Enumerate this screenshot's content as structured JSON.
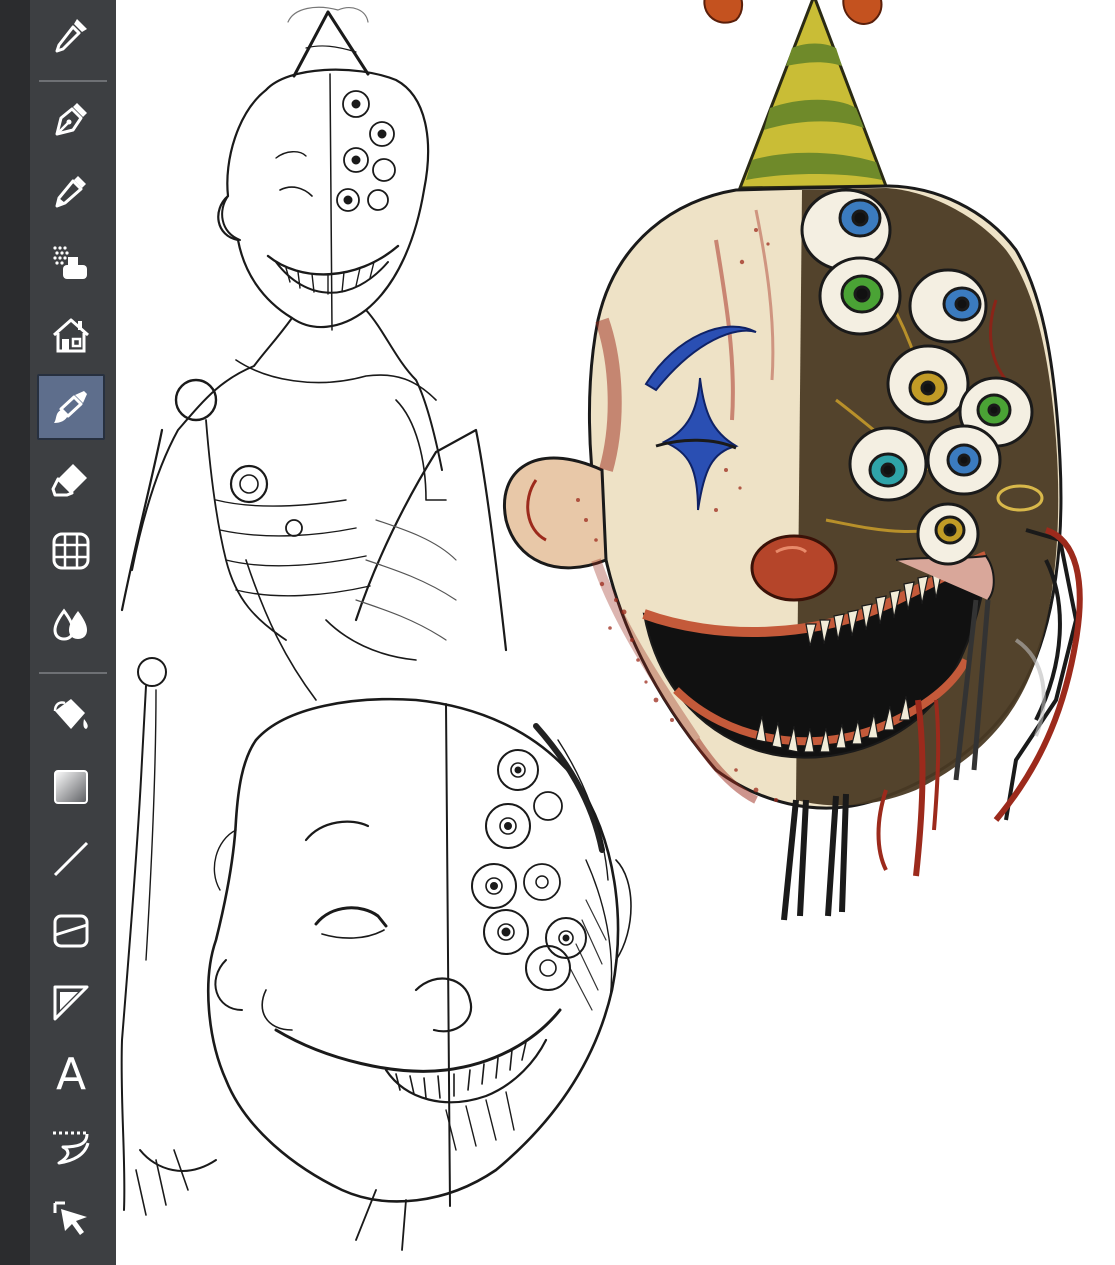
{
  "toolbar": {
    "tools": [
      {
        "name": "eyedropper",
        "icon": "eyedropper-icon"
      },
      {
        "name": "pen",
        "icon": "pen-nib-icon"
      },
      {
        "name": "pencil",
        "icon": "pencil-icon"
      },
      {
        "name": "airbrush",
        "icon": "airbrush-icon"
      },
      {
        "name": "decoration",
        "icon": "house-decoration-icon"
      },
      {
        "name": "brush",
        "icon": "brush-icon",
        "selected": true
      },
      {
        "name": "eraser",
        "icon": "eraser-icon"
      },
      {
        "name": "figure",
        "icon": "grid-figure-icon"
      },
      {
        "name": "blend",
        "icon": "blend-drops-icon"
      },
      {
        "name": "fill",
        "icon": "paint-bucket-icon"
      },
      {
        "name": "gradient",
        "icon": "gradient-icon"
      },
      {
        "name": "line",
        "icon": "line-icon"
      },
      {
        "name": "frame-border",
        "icon": "frame-border-icon"
      },
      {
        "name": "ruler",
        "icon": "ruler-icon"
      },
      {
        "name": "text",
        "icon": "text-icon",
        "glyph": "A"
      },
      {
        "name": "balloon",
        "icon": "balloon-icon"
      },
      {
        "name": "operation",
        "icon": "object-select-icon"
      }
    ]
  },
  "colors": {
    "toolbar_bg": "#3d3f42",
    "edge_strip": "#2b2c2e",
    "selected_tool_bg": "#5e6e8c",
    "icon": "#ffffff",
    "canvas_bg": "#ffffff",
    "skin": "#eee2c6",
    "hat_yellow": "#c9bd36",
    "hat_green": "#6f8a2a",
    "clown_blue": "#2a4fb3",
    "nose_red": "#b5452a",
    "hair_orange": "#c4521f",
    "blood": "#9c2a1c"
  },
  "canvas": {
    "artwork": [
      "clown-sketch-full-body",
      "clown-sketch-head",
      "clown-head-colored"
    ]
  }
}
